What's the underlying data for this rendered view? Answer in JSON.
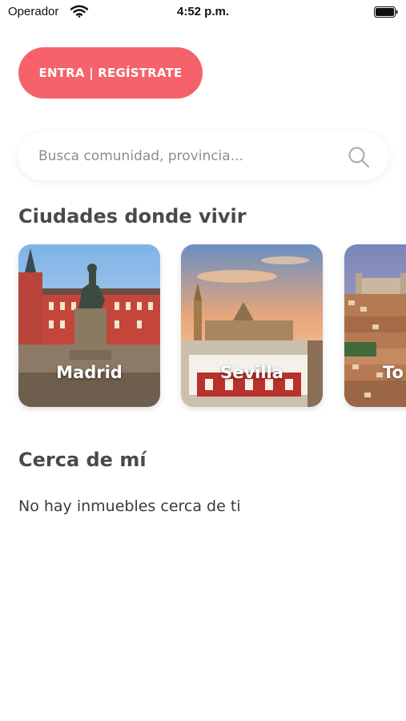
{
  "status_bar": {
    "carrier": "Operador",
    "time": "4:52 p.m."
  },
  "auth": {
    "button_label": "ENTRA | REGÍSTRATE",
    "color": "#f5626a"
  },
  "search": {
    "placeholder": "Busca comunidad, provincia..."
  },
  "cities_section": {
    "title": "Ciudades donde vivir",
    "cities": [
      {
        "name": "Madrid"
      },
      {
        "name": "Sevilla"
      },
      {
        "name": "To"
      }
    ]
  },
  "nearby_section": {
    "title": "Cerca de mí",
    "empty_message": "No hay inmuebles cerca de ti"
  }
}
